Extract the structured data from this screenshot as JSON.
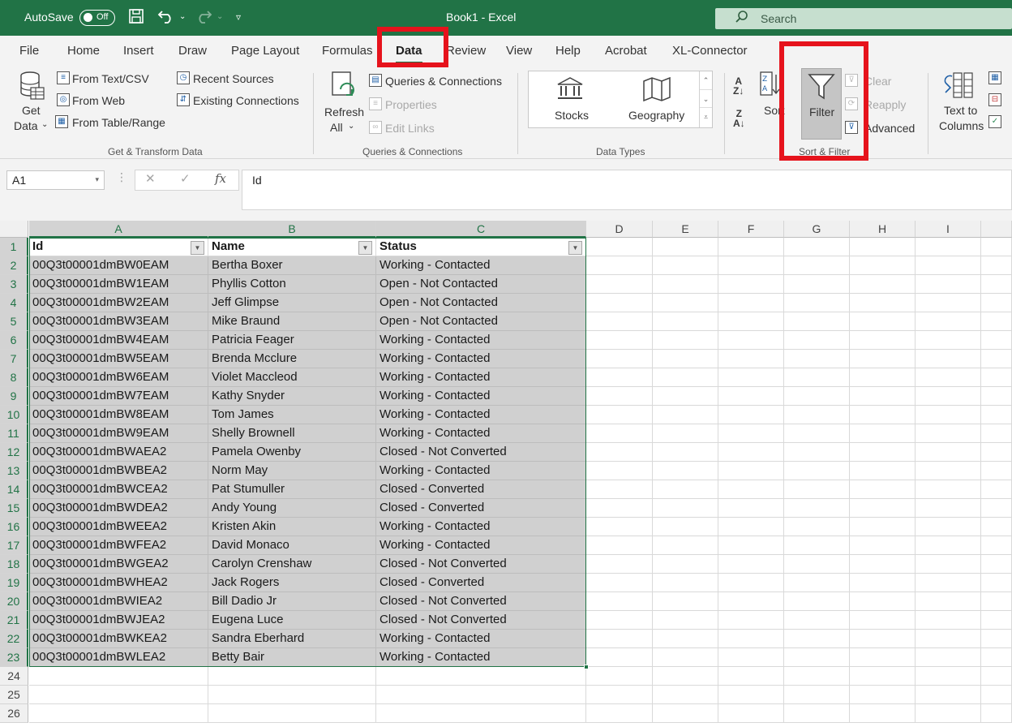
{
  "titlebar": {
    "autosave_label": "AutoSave",
    "toggle_state": "Off",
    "title": "Book1  -  Excel",
    "search_placeholder": "Search"
  },
  "tabs": [
    {
      "label": "File"
    },
    {
      "label": "Home"
    },
    {
      "label": "Insert"
    },
    {
      "label": "Draw"
    },
    {
      "label": "Page Layout"
    },
    {
      "label": "Formulas"
    },
    {
      "label": "Data",
      "active": true
    },
    {
      "label": "Review"
    },
    {
      "label": "View"
    },
    {
      "label": "Help"
    },
    {
      "label": "Acrobat"
    },
    {
      "label": "XL-Connector"
    }
  ],
  "ribbon": {
    "get_data_line1": "Get",
    "get_data_line2": "Data",
    "from_text_csv": "From Text/CSV",
    "from_web": "From Web",
    "from_table_range": "From Table/Range",
    "recent_sources": "Recent Sources",
    "existing_connections": "Existing Connections",
    "group_get_transform": "Get & Transform Data",
    "refresh_line1": "Refresh",
    "refresh_line2": "All",
    "queries_connections": "Queries & Connections",
    "properties": "Properties",
    "edit_links": "Edit Links",
    "group_queries": "Queries & Connections",
    "stocks": "Stocks",
    "geography": "Geography",
    "group_data_types": "Data Types",
    "sort": "Sort",
    "filter": "Filter",
    "clear": "Clear",
    "reapply": "Reapply",
    "advanced": "Advanced",
    "group_sort_filter": "Sort & Filter",
    "text_to_columns_line1": "Text to",
    "text_to_columns_line2": "Columns"
  },
  "formula_bar": {
    "name_box": "A1",
    "fx": "fx",
    "value": "Id"
  },
  "sheet": {
    "columns": [
      "A",
      "B",
      "C",
      "D",
      "E",
      "F",
      "G",
      "H",
      "I"
    ],
    "row_numbers": [
      "1",
      "2",
      "3",
      "4",
      "5",
      "6",
      "7",
      "8",
      "9",
      "10",
      "11",
      "12",
      "13",
      "14",
      "15",
      "16",
      "17",
      "18",
      "19",
      "20",
      "21",
      "22",
      "23",
      "24",
      "25",
      "26"
    ],
    "headers": [
      "Id",
      "Name",
      "Status"
    ],
    "rows": [
      [
        "00Q3t00001dmBW0EAM",
        "Bertha Boxer",
        "Working - Contacted"
      ],
      [
        "00Q3t00001dmBW1EAM",
        "Phyllis Cotton",
        "Open - Not Contacted"
      ],
      [
        "00Q3t00001dmBW2EAM",
        "Jeff Glimpse",
        "Open - Not Contacted"
      ],
      [
        "00Q3t00001dmBW3EAM",
        "Mike Braund",
        "Open - Not Contacted"
      ],
      [
        "00Q3t00001dmBW4EAM",
        "Patricia Feager",
        "Working - Contacted"
      ],
      [
        "00Q3t00001dmBW5EAM",
        "Brenda Mcclure",
        "Working - Contacted"
      ],
      [
        "00Q3t00001dmBW6EAM",
        "Violet Maccleod",
        "Working - Contacted"
      ],
      [
        "00Q3t00001dmBW7EAM",
        "Kathy Snyder",
        "Working - Contacted"
      ],
      [
        "00Q3t00001dmBW8EAM",
        "Tom James",
        "Working - Contacted"
      ],
      [
        "00Q3t00001dmBW9EAM",
        "Shelly Brownell",
        "Working - Contacted"
      ],
      [
        "00Q3t00001dmBWAEA2",
        "Pamela Owenby",
        "Closed - Not Converted"
      ],
      [
        "00Q3t00001dmBWBEA2",
        "Norm May",
        "Working - Contacted"
      ],
      [
        "00Q3t00001dmBWCEA2",
        "Pat Stumuller",
        "Closed - Converted"
      ],
      [
        "00Q3t00001dmBWDEA2",
        "Andy Young",
        "Closed - Converted"
      ],
      [
        "00Q3t00001dmBWEEA2",
        "Kristen Akin",
        "Working - Contacted"
      ],
      [
        "00Q3t00001dmBWFEA2",
        "David Monaco",
        "Working - Contacted"
      ],
      [
        "00Q3t00001dmBWGEA2",
        "Carolyn Crenshaw",
        "Closed - Not Converted"
      ],
      [
        "00Q3t00001dmBWHEA2",
        "Jack Rogers",
        "Closed - Converted"
      ],
      [
        "00Q3t00001dmBWIEA2",
        "Bill Dadio Jr",
        "Closed - Not Converted"
      ],
      [
        "00Q3t00001dmBWJEA2",
        "Eugena Luce",
        "Closed - Not Converted"
      ],
      [
        "00Q3t00001dmBWKEA2",
        "Sandra Eberhard",
        "Working - Contacted"
      ],
      [
        "00Q3t00001dmBWLEA2",
        "Betty Bair",
        "Working - Contacted"
      ]
    ]
  },
  "colors": {
    "excel_green": "#217346",
    "highlight_red": "#e6131c",
    "selection_fill": "#d0d0d0"
  }
}
